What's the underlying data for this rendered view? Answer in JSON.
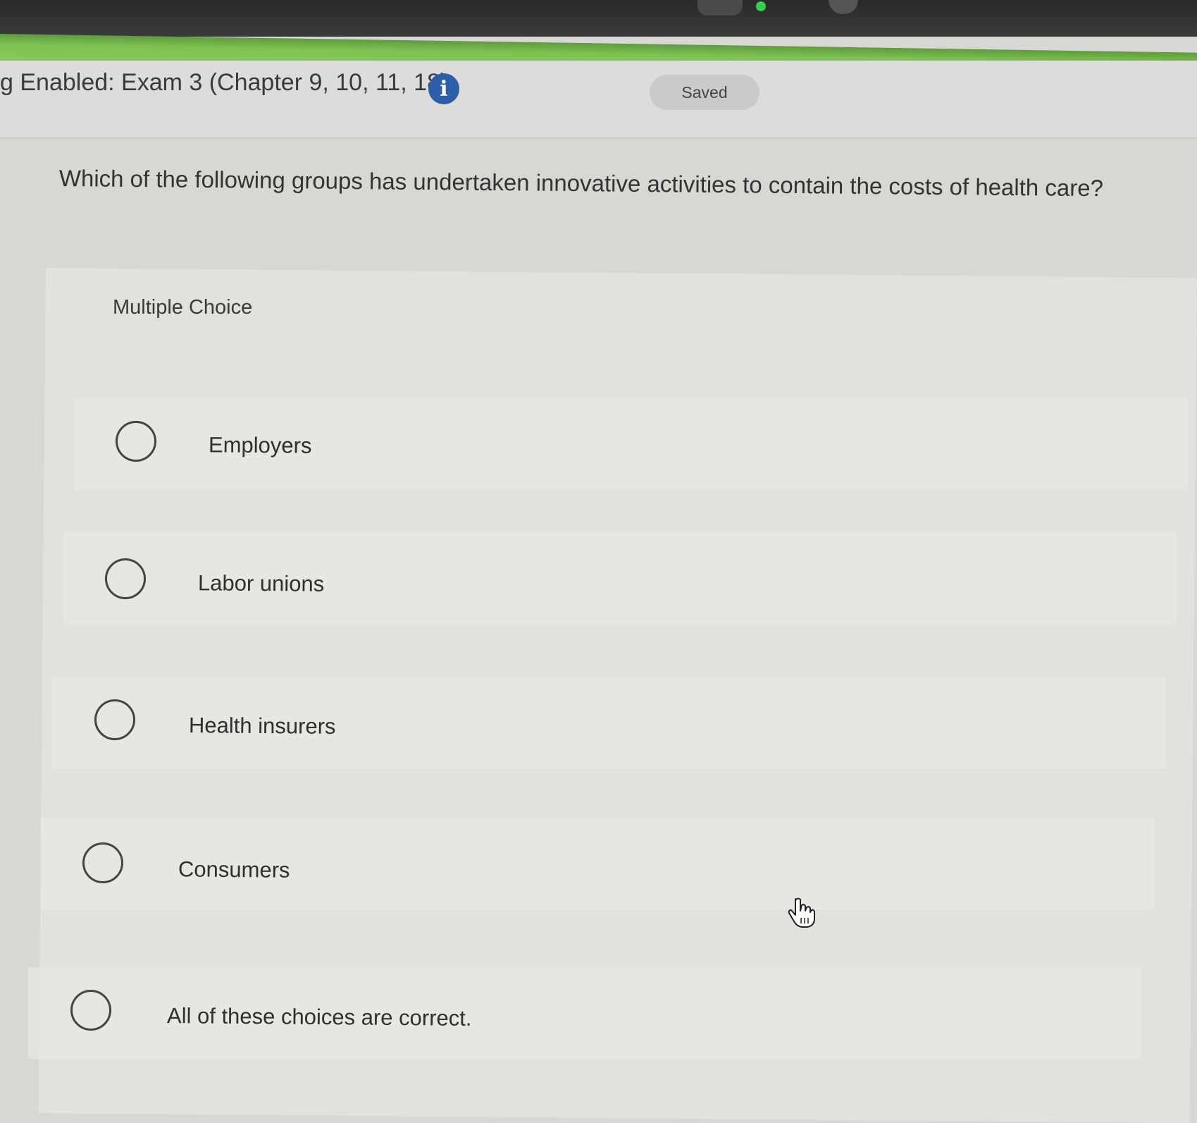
{
  "header": {
    "title": "g Enabled: Exam 3 (Chapter 9, 10, 11, 18)",
    "info_icon": "info-icon",
    "saved_label": "Saved"
  },
  "question": {
    "text": "Which of the following groups has undertaken innovative activities to contain the costs of health care?",
    "type_label": "Multiple Choice",
    "options": [
      {
        "label": "Employers",
        "selected": false
      },
      {
        "label": "Labor unions",
        "selected": false
      },
      {
        "label": "Health insurers",
        "selected": false
      },
      {
        "label": "Consumers",
        "selected": false
      },
      {
        "label": "All of these choices are correct.",
        "selected": false
      }
    ]
  },
  "colors": {
    "accent_bar": "#7fc251",
    "info_icon": "#2d5fa9",
    "background": "#d9d7d4"
  },
  "cursor": "hand-pointer-icon"
}
